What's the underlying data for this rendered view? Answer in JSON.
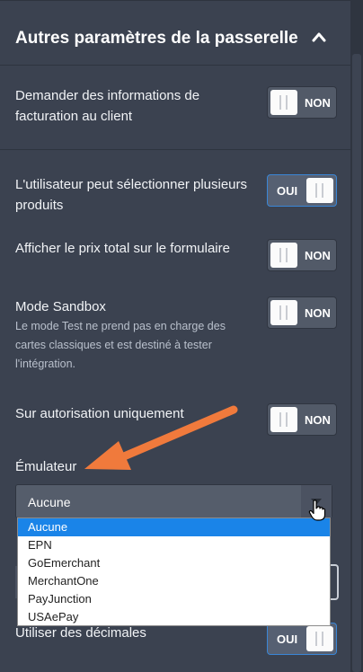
{
  "section": {
    "title": "Autres paramètres de la passerelle"
  },
  "settings": [
    {
      "label": "Demander des informations de facturation au client",
      "state": "NON"
    },
    {
      "label": "L'utilisateur peut sélectionner plusieurs produits",
      "state": "OUI"
    },
    {
      "label": "Afficher le prix total sur le formulaire",
      "state": "NON"
    },
    {
      "label": "Mode Sandbox",
      "description": "Le mode Test ne prend pas en charge des cartes classiques et est destiné à tester l'intégration.",
      "state": "NON"
    },
    {
      "label": "Sur autorisation uniquement",
      "state": "NON"
    }
  ],
  "emulator": {
    "label": "Émulateur",
    "selected": "Aucune",
    "options": [
      "Aucune",
      "EPN",
      "GoEmerchant",
      "MerchantOne",
      "PayJunction",
      "USAePay"
    ]
  },
  "decimals": {
    "label": "Utiliser des décimales",
    "state": "OUI"
  },
  "colors": {
    "background": "#3b4250",
    "toggle_on_border": "#3a86d6",
    "arrow": "#f07a3c",
    "selected_option": "#1a84e8"
  },
  "icons": {
    "collapse": "chevron-up-icon",
    "dropdown": "caret-down-icon",
    "cursor": "hand-cursor-icon",
    "annotation": "orange-arrow"
  }
}
